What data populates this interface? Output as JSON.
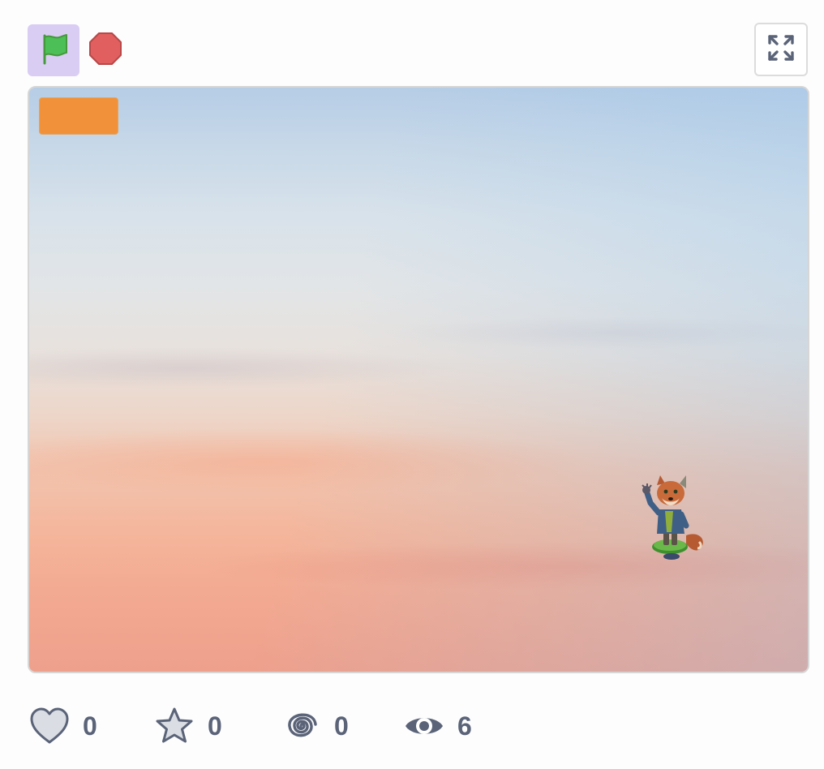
{
  "toolbar": {
    "icons": [
      "green-flag-icon",
      "stop-icon",
      "fullscreen-icon"
    ],
    "green_flag_bg": "#d9cdf3",
    "flag_color": "#4cbf56",
    "stop_color": "#e15f5f"
  },
  "stage": {
    "background": "sunset-sky",
    "button_color": "#f1923a",
    "sprite": "fox-character"
  },
  "stats": {
    "loves": "0",
    "favorites": "0",
    "remixes": "0",
    "views": "6"
  }
}
